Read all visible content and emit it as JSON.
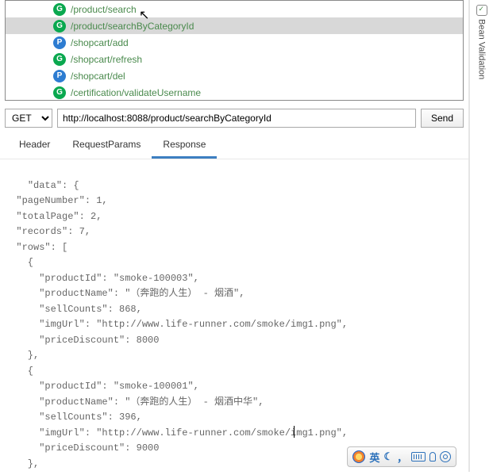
{
  "endpoints": [
    {
      "method": "G",
      "path": "/product/search",
      "selected": false
    },
    {
      "method": "G",
      "path": "/product/searchByCategoryId",
      "selected": true
    },
    {
      "method": "P",
      "path": "/shopcart/add",
      "selected": false
    },
    {
      "method": "G",
      "path": "/shopcart/refresh",
      "selected": false
    },
    {
      "method": "P",
      "path": "/shopcart/del",
      "selected": false
    },
    {
      "method": "G",
      "path": "/certification/validateUsername",
      "selected": false
    }
  ],
  "request": {
    "method": "GET",
    "url": "http://localhost:8088/product/searchByCategoryId",
    "send_label": "Send"
  },
  "tabs": [
    {
      "label": "Header",
      "active": false
    },
    {
      "label": "RequestParams",
      "active": false
    },
    {
      "label": "Response",
      "active": true
    }
  ],
  "response_text": "\"data\": {\n  \"pageNumber\": 1,\n  \"totalPage\": 2,\n  \"records\": 7,\n  \"rows\": [\n    {\n      \"productId\": \"smoke-100003\",\n      \"productName\": \"（奔跑的人生） - 烟酒\",\n      \"sellCounts\": 868,\n      \"imgUrl\": \"http://www.life-runner.com/smoke/img1.png\",\n      \"priceDiscount\": 8000\n    },\n    {\n      \"productId\": \"smoke-100001\",\n      \"productName\": \"（奔跑的人生） - 烟酒中华\",\n      \"sellCounts\": 396,\n      \"imgUrl\": \"http://www.life-runner.com/smoke/img1.png\",\n      \"priceDiscount\": 9000\n    },",
  "side_panel": {
    "label": "Bean Validation"
  },
  "ime": {
    "lang": "英",
    "moon": "☾",
    "comma_cn": "，"
  }
}
